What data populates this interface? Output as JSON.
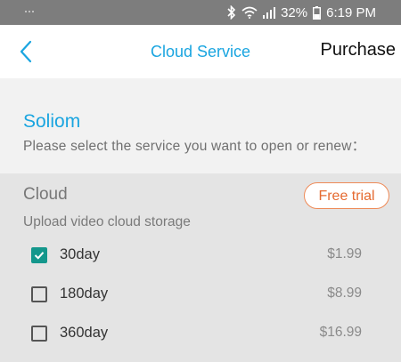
{
  "status_bar": {
    "battery": "32%",
    "time": "6:19 PM",
    "icons": [
      "bluetooth-icon",
      "wifi-icon",
      "signal-icon",
      "battery-icon"
    ]
  },
  "header": {
    "back_icon": "chevron-left-icon",
    "title": "Cloud Service",
    "purchase_label": "Purchase"
  },
  "service": {
    "brand": "Soliom",
    "instruction": "Please select the service you want to open or renew："
  },
  "plan": {
    "name": "Cloud",
    "badge": "Free trial",
    "description": "Upload video cloud storage",
    "options": [
      {
        "label": "30day",
        "price": "$1.99",
        "checked": true
      },
      {
        "label": "180day",
        "price": "$8.99",
        "checked": false
      },
      {
        "label": "360day",
        "price": "$16.99",
        "checked": false
      }
    ]
  },
  "colors": {
    "accent": "#1aa5e0",
    "check": "#14978c",
    "badge": "#e56a30",
    "statusbar": "#7d7d7d"
  }
}
